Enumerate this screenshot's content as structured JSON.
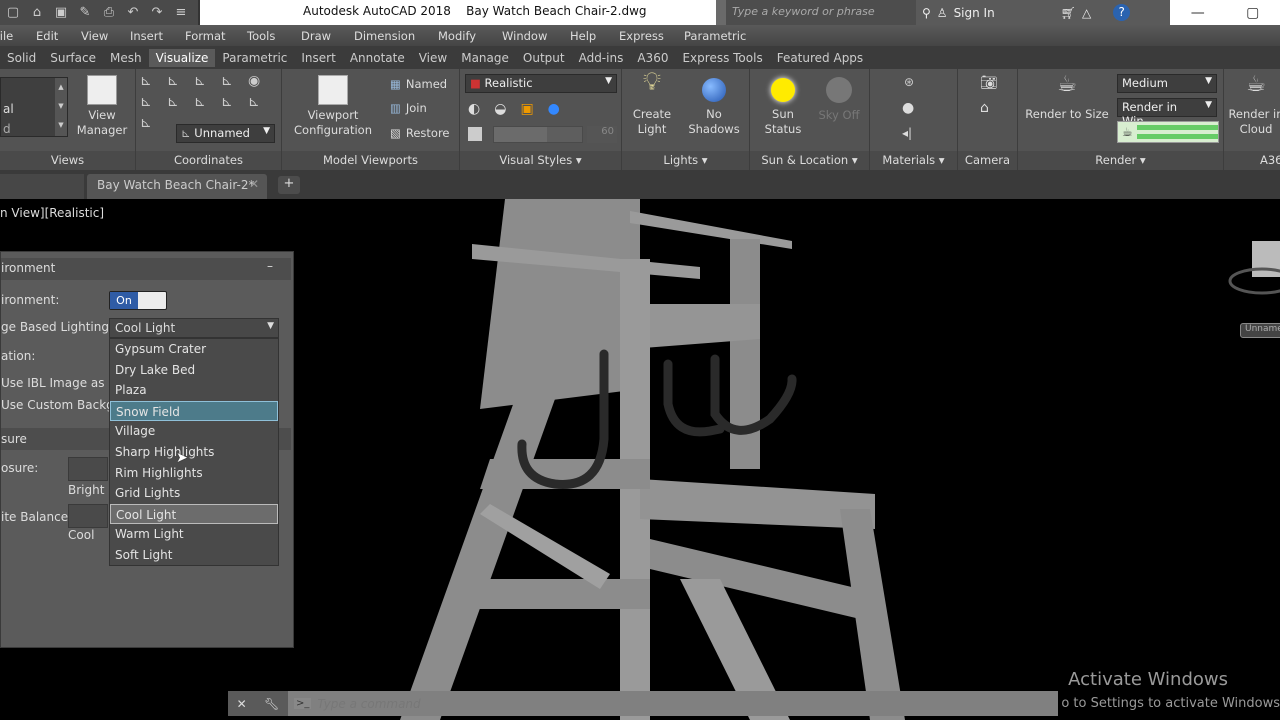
{
  "title_bar": {
    "quick_access_icons": [
      "new-icon",
      "open-icon",
      "save-icon",
      "save-as-icon",
      "plot-icon",
      "undo-icon",
      "redo-icon",
      "customize-icon"
    ],
    "app_title": "Autodesk AutoCAD 2018    Bay Watch Beach Chair-2.dwg",
    "search_placeholder": "Type a keyword or phrase",
    "sign_in": "Sign In"
  },
  "menu_bar": [
    "File",
    "Edit",
    "View",
    "Insert",
    "Format",
    "Tools",
    "Draw",
    "Dimension",
    "Modify",
    "Window",
    "Help",
    "Express",
    "Parametric"
  ],
  "ribbon_tabs": [
    {
      "label": "Solid",
      "active": false
    },
    {
      "label": "Surface",
      "active": false
    },
    {
      "label": "Mesh",
      "active": false
    },
    {
      "label": "Visualize",
      "active": true
    },
    {
      "label": "Parametric",
      "active": false
    },
    {
      "label": "Insert",
      "active": false
    },
    {
      "label": "Annotate",
      "active": false
    },
    {
      "label": "View",
      "active": false
    },
    {
      "label": "Manage",
      "active": false
    },
    {
      "label": "Output",
      "active": false
    },
    {
      "label": "Add-ins",
      "active": false
    },
    {
      "label": "A360",
      "active": false
    },
    {
      "label": "Express Tools",
      "active": false
    },
    {
      "label": "Featured Apps",
      "active": false
    }
  ],
  "ribbon": {
    "views": {
      "label": "Views",
      "list_items": [
        "al",
        "d"
      ],
      "view_manager": "View\nManager"
    },
    "coordinates": {
      "label": "Coordinates",
      "ucs_dropdown": "Unnamed"
    },
    "model_viewports": {
      "label": "Model Viewports",
      "config": "Viewport\nConfiguration",
      "named": "Named",
      "join": "Join",
      "restore": "Restore"
    },
    "visual_styles": {
      "label": "Visual Styles",
      "style": "Realistic",
      "slider_value": "60"
    },
    "lights": {
      "label": "Lights",
      "create_light": "Create\nLight",
      "no_shadows": "No\nShadows"
    },
    "sun_location": {
      "label": "Sun & Location",
      "sun_status": "Sun\nStatus",
      "sky_off": "Sky Off"
    },
    "materials": {
      "label": "Materials"
    },
    "camera": {
      "label": "Camera"
    },
    "render": {
      "label": "Render",
      "render_to_size": "Render to Size",
      "quality": "Medium",
      "render_in": "Render in Win...",
      "progress": 1.0
    },
    "a360": {
      "label": "A36",
      "render_in_cloud": "Render in\nCloud"
    }
  },
  "doc_tabs": {
    "active": "Bay Watch Beach Chair-2*"
  },
  "viewport": {
    "label": "n View][Realistic]",
    "viewcube_label": "Unnamed"
  },
  "render_env_panel": {
    "header": "ironment",
    "environment_label": "ironment:",
    "environment_toggle": "On",
    "ibl_label": "ge Based Lighting:",
    "ibl_value": "Cool Light",
    "rotation_label": "ation:",
    "use_ibl_bg": "Use IBL Image as Ba",
    "use_custom_bg": "Use Custom Backgr",
    "exposure_section": "sure",
    "exposure_label": "osure:",
    "bright_label": "Bright",
    "white_balance_label": "ite Balance:",
    "cool_label": "Cool",
    "ibl_options": [
      {
        "label": "Gypsum Crater",
        "state": ""
      },
      {
        "label": "Dry Lake Bed",
        "state": ""
      },
      {
        "label": "Plaza",
        "state": ""
      },
      {
        "label": "Snow Field",
        "state": "hover"
      },
      {
        "label": "Village",
        "state": ""
      },
      {
        "label": "Sharp Highlights",
        "state": ""
      },
      {
        "label": "Rim Highlights",
        "state": ""
      },
      {
        "label": "Grid Lights",
        "state": ""
      },
      {
        "label": "Cool Light",
        "state": "selected"
      },
      {
        "label": "Warm Light",
        "state": ""
      },
      {
        "label": "Soft Light",
        "state": ""
      }
    ]
  },
  "command_line": {
    "placeholder": "Type a command"
  },
  "watermark": {
    "line1": "Activate Windows",
    "line2": "o to Settings to activate Windows"
  }
}
